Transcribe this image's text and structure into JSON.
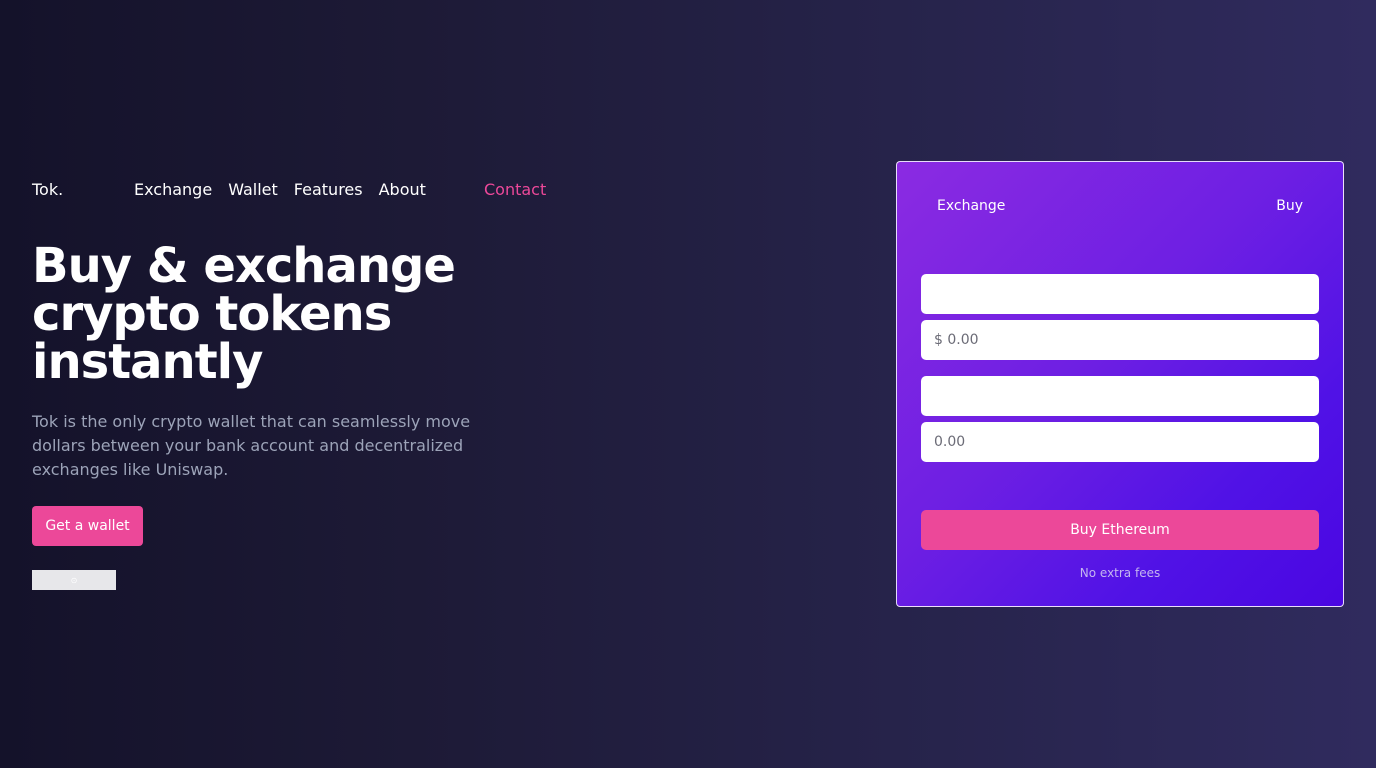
{
  "header": {
    "logo": "Tok.",
    "nav": [
      "Exchange",
      "Wallet",
      "Features",
      "About"
    ],
    "contact": "Contact"
  },
  "hero": {
    "title": "Buy & exchange crypto tokens instantly",
    "description": "Tok is the only crypto wallet that can seamlessly move dollars between your bank account and decentralized exchanges like Uniswap.",
    "cta_label": "Get a wallet"
  },
  "widget": {
    "tabs": [
      "Exchange",
      "Buy"
    ],
    "fields": [
      {
        "value": "",
        "placeholder": ""
      },
      {
        "value": "",
        "placeholder": "$ 0.00"
      },
      {
        "value": "",
        "placeholder": ""
      },
      {
        "value": "",
        "placeholder": "0.00"
      }
    ],
    "buy_label": "Buy Ethereum",
    "note": "No extra fees"
  },
  "colors": {
    "accent": "#ec4899",
    "card_from": "#8b2be2",
    "card_to": "#4a06e2",
    "background": "#1d1a36"
  }
}
